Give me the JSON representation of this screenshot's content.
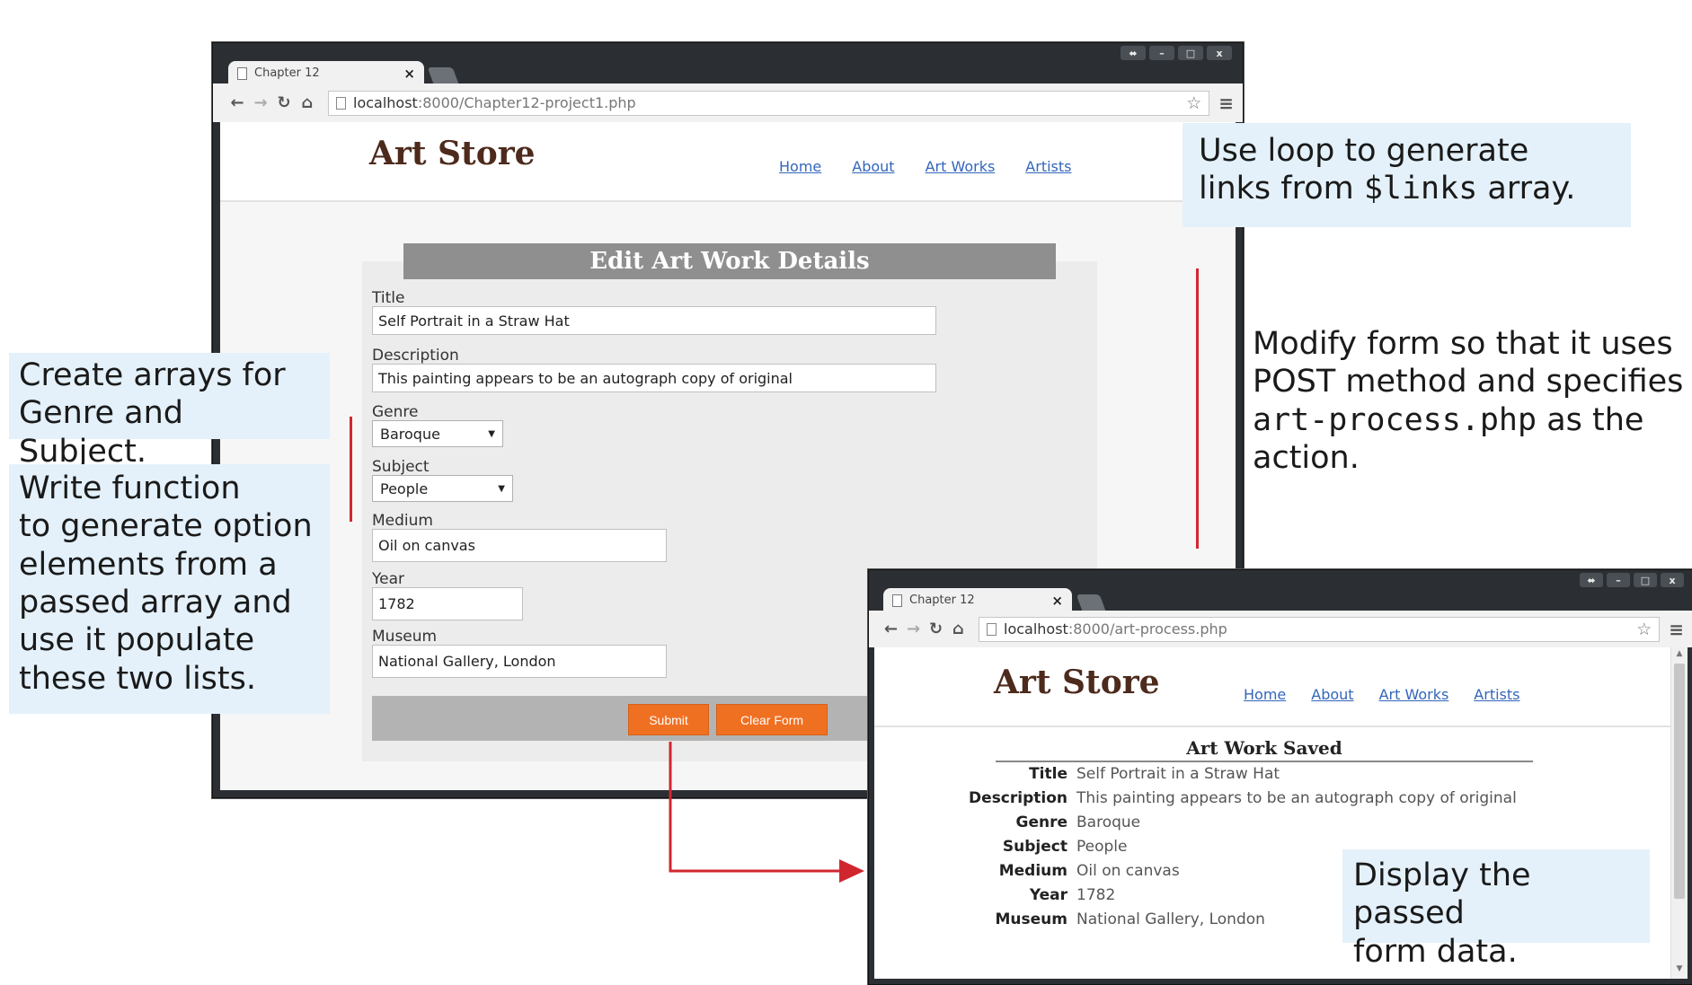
{
  "colors": {
    "callout_bg": "#e4f1fa",
    "accent_button": "#f07022",
    "annotation_line": "#d0272f",
    "site_title": "#4d2a1c",
    "nav_link": "#3366bb",
    "form_heading_bg": "#8f8f8f"
  },
  "form_window": {
    "tab_title": "Chapter 12",
    "tab_close": "×",
    "url_host": "localhost",
    "url_rest": ":8000/Chapter12-project1.php",
    "window_controls": [
      "⬌",
      "–",
      "□",
      "x"
    ],
    "site_title": "Art Store",
    "nav": [
      "Home",
      "About",
      "Art Works",
      "Artists"
    ],
    "form": {
      "heading": "Edit Art Work Details",
      "fields": {
        "title": {
          "label": "Title",
          "value": "Self Portrait in a Straw Hat"
        },
        "description": {
          "label": "Description",
          "value": "This painting appears to be an autograph copy of original"
        },
        "genre": {
          "label": "Genre",
          "value": "Baroque"
        },
        "subject": {
          "label": "Subject",
          "value": "People"
        },
        "medium": {
          "label": "Medium",
          "value": "Oil on canvas"
        },
        "year": {
          "label": "Year",
          "value": "1782"
        },
        "museum": {
          "label": "Museum",
          "value": "National Gallery, London"
        }
      },
      "submit_label": "Submit",
      "clear_label": "Clear Form"
    }
  },
  "result_window": {
    "tab_title": "Chapter 12",
    "tab_close": "×",
    "url_host": "localhost",
    "url_rest": ":8000/art-process.php",
    "window_controls": [
      "⬌",
      "–",
      "□",
      "x"
    ],
    "site_title": "Art Store",
    "nav": [
      "Home",
      "About",
      "Art Works",
      "Artists"
    ],
    "saved_heading": "Art Work Saved",
    "rows": [
      {
        "label": "Title",
        "value": "Self Portrait in a Straw Hat"
      },
      {
        "label": "Description",
        "value": "This painting appears to be an autograph copy of original"
      },
      {
        "label": "Genre",
        "value": "Baroque"
      },
      {
        "label": "Subject",
        "value": "People"
      },
      {
        "label": "Medium",
        "value": "Oil on canvas"
      },
      {
        "label": "Year",
        "value": "1782"
      },
      {
        "label": "Museum",
        "value": "National Gallery, London"
      }
    ]
  },
  "callouts": {
    "loop_links_pre": "Use loop to generate\nlinks from ",
    "loop_links_code": "$links",
    "loop_links_post": " array.",
    "arrays": "Create arrays for\nGenre and Subject.",
    "function": "Write function\nto generate option\nelements from a\npassed array and\nuse it populate\nthese two lists.",
    "modify_form_pre": "Modify form so that it uses\nPOST method and specifies\n",
    "modify_form_code": "art-process.php",
    "modify_form_post": " as the\naction.",
    "display": "Display the passed\nform data."
  },
  "icons": {
    "back": "arrow-left-icon",
    "forward": "arrow-right-icon",
    "reload": "reload-icon",
    "home": "home-icon",
    "bookmark": "star-icon",
    "menu": "hamburger-menu-icon",
    "page": "page-icon"
  }
}
